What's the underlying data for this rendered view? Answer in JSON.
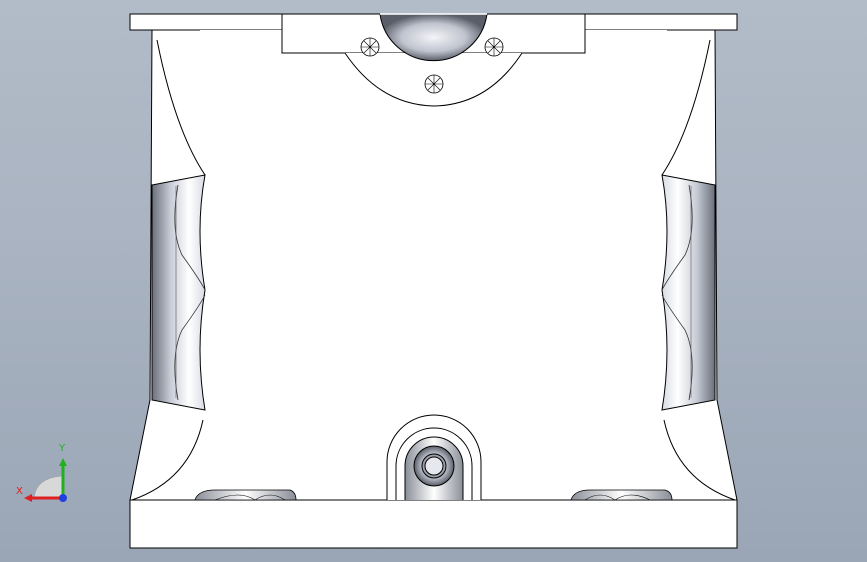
{
  "viewport": {
    "background_top": "#b2bcc8",
    "background_bottom": "#9aa6b6",
    "part_fill": "#ffffff",
    "edge_color": "#000000"
  },
  "triad": {
    "x_label": "X",
    "y_label": "Y",
    "x_color": "#e02020",
    "y_color": "#20b020",
    "z_color": "#2040e0"
  }
}
